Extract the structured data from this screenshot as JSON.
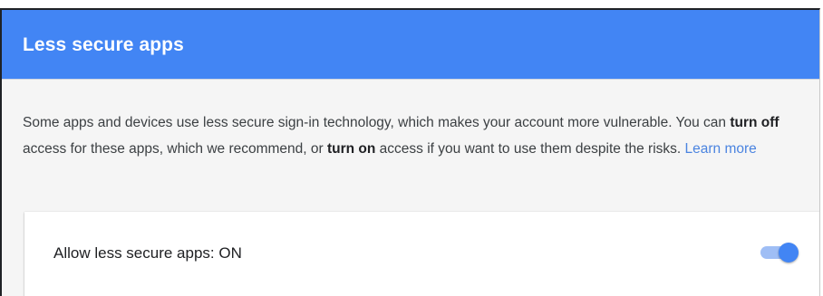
{
  "header": {
    "title": "Less secure apps"
  },
  "description": {
    "part1": "Some apps and devices use less secure sign-in technology, which makes your account more vulnerable. You can ",
    "turn_off": "turn off",
    "part2": " access for these apps, which we recommend, or ",
    "turn_on": "turn on",
    "part3": " access if you want to use them despite the risks. ",
    "learn_more": "Learn more"
  },
  "setting": {
    "label": "Allow less secure apps: ON",
    "toggle_on": true
  },
  "colors": {
    "header_bg": "#4285f4",
    "link": "#4b84e0",
    "toggle_thumb": "#4285f4",
    "toggle_track": "#9fbef5"
  },
  "icons": {
    "toggle": "toggle-switch-on"
  }
}
